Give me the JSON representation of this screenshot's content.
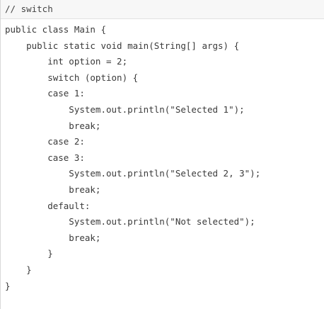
{
  "header": {
    "comment": "// switch"
  },
  "code": {
    "lines": [
      "public class Main {",
      "    public static void main(String[] args) {",
      "        int option = 2;",
      "        switch (option) {",
      "        case 1:",
      "            System.out.println(\"Selected 1\");",
      "            break;",
      "        case 2:",
      "        case 3:",
      "            System.out.println(\"Selected 2, 3\");",
      "            break;",
      "        default:",
      "            System.out.println(\"Not selected\");",
      "            break;",
      "        }",
      "    }",
      "}"
    ]
  },
  "colors": {
    "header_background": "#f7f7f7",
    "text": "#3a3a3a",
    "border": "#d8d8d8"
  }
}
